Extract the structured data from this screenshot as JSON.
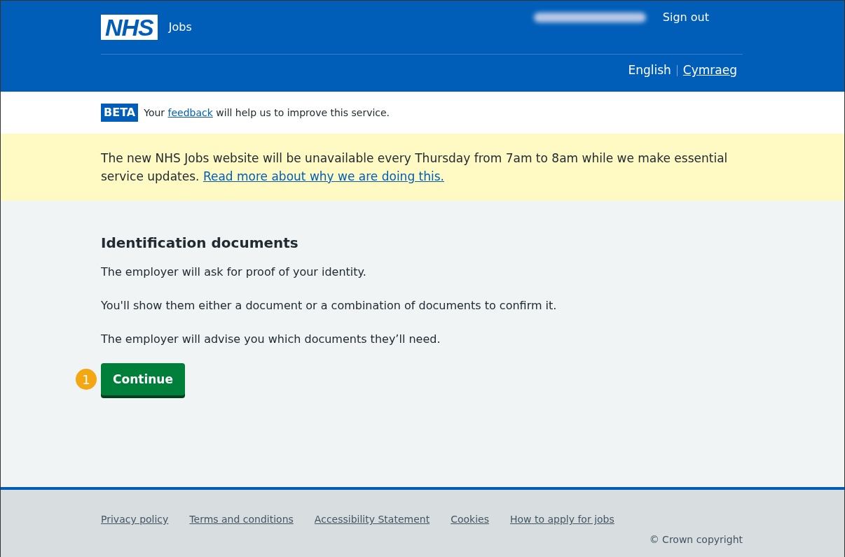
{
  "header": {
    "logo": "NHS",
    "service_name": "Jobs",
    "account_link": "Sign out",
    "languages": [
      {
        "label": "English",
        "selected": true
      },
      {
        "label": "Cymraeg",
        "selected": false
      }
    ]
  },
  "phase_banner": {
    "tag": "BETA",
    "before": "Your",
    "link": "feedback",
    "after": "will help us to improve this service."
  },
  "notice": {
    "text": "The new NHS Jobs website will be unavailable every Thursday from 7am to 8am while we make essential service updates.",
    "link": "Read more about why we are doing this."
  },
  "main": {
    "heading": "Identification documents",
    "paragraphs": [
      "The employer will ask for proof of your identity.",
      "You'll show them either a document or a combination of documents to confirm it.",
      "The employer will advise you which documents they’ll need."
    ],
    "step_marker": "1",
    "button": "Continue"
  },
  "footer": {
    "links": [
      "Privacy policy",
      "Terms and conditions",
      "Accessibility Statement",
      "Cookies",
      "How to apply for jobs"
    ],
    "copyright": "© Crown copyright"
  }
}
